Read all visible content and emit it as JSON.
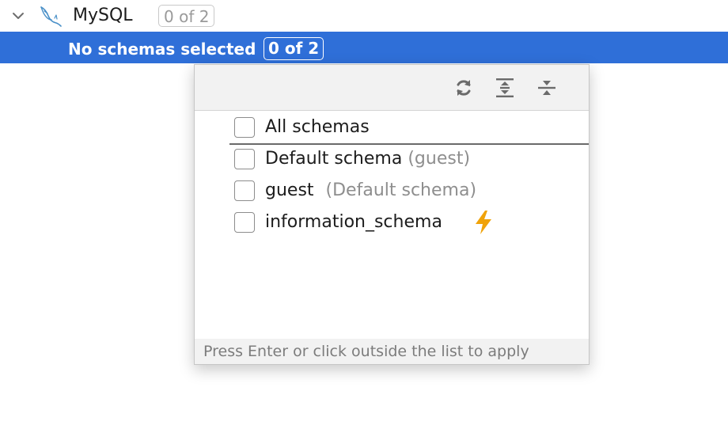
{
  "tree": {
    "connection_label": "MySQL",
    "connection_badge": "0 of 2",
    "selected_row_label": "No schemas selected",
    "selected_row_badge": "0 of 2"
  },
  "popup": {
    "toolbar": {
      "refresh_icon": "refresh-icon",
      "expand_all_icon": "expand-all-icon",
      "collapse_all_icon": "collapse-all-icon"
    },
    "items": [
      {
        "label": "All schemas",
        "hint": "",
        "checked": false
      },
      {
        "label": "Default schema",
        "hint": "(guest)",
        "checked": false
      },
      {
        "label": "guest",
        "hint": "(Default schema)",
        "checked": false
      },
      {
        "label": "information_schema",
        "hint": "",
        "checked": false,
        "icon": "lightning-bolt-icon"
      }
    ],
    "footer_text": "Press Enter or click outside the list to apply"
  },
  "colors": {
    "selection_bg": "#2f6fd8",
    "bolt": "#f0a30a"
  }
}
